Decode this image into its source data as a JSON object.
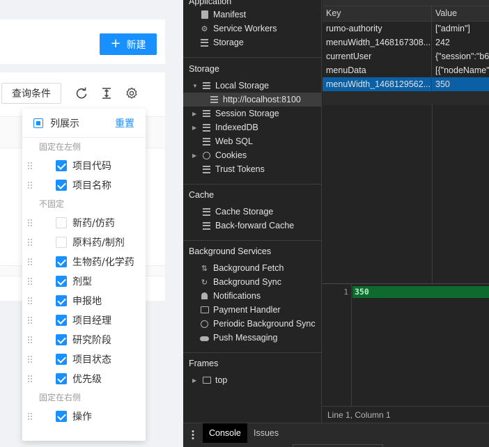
{
  "app": {
    "new_button": "新建",
    "query_button": "查询条件",
    "icons": [
      "reload-icon",
      "column-height-icon",
      "setting-icon"
    ],
    "column_panel": {
      "title": "列展示",
      "reset": "重置",
      "groups": [
        {
          "title": "固定在左侧",
          "items": [
            {
              "label": "项目代码",
              "checked": true
            },
            {
              "label": "项目名称",
              "checked": true
            }
          ]
        },
        {
          "title": "不固定",
          "items": [
            {
              "label": "新药/仿药",
              "checked": false
            },
            {
              "label": "原料药/制剂",
              "checked": false
            },
            {
              "label": "生物药/化学药",
              "checked": true
            },
            {
              "label": "剂型",
              "checked": true
            },
            {
              "label": "申报地",
              "checked": true
            },
            {
              "label": "项目经理",
              "checked": true
            },
            {
              "label": "研究阶段",
              "checked": true
            },
            {
              "label": "项目状态",
              "checked": true
            },
            {
              "label": "优先级",
              "checked": true
            }
          ]
        },
        {
          "title": "固定在右侧",
          "items": [
            {
              "label": "操作",
              "checked": true
            }
          ]
        }
      ]
    }
  },
  "devtools": {
    "application_label": "Application",
    "app_items": [
      "Manifest",
      "Service Workers",
      "Storage"
    ],
    "storage_label": "Storage",
    "local_storage": "Local Storage",
    "local_origin": "http://localhost:8100",
    "session_storage": "Session Storage",
    "indexeddb": "IndexedDB",
    "websql": "Web SQL",
    "cookies": "Cookies",
    "trust_tokens": "Trust Tokens",
    "cache_label": "Cache",
    "cache_items": [
      "Cache Storage",
      "Back-forward Cache"
    ],
    "bg_label": "Background Services",
    "bg_items": [
      "Background Fetch",
      "Background Sync",
      "Notifications",
      "Payment Handler",
      "Periodic Background Sync",
      "Push Messaging"
    ],
    "frames_label": "Frames",
    "frames_top": "top",
    "table": {
      "key_header": "Key",
      "value_header": "Value",
      "rows": [
        {
          "key": "rumo-authority",
          "value": "[\"admin\"]"
        },
        {
          "key": "menuWidth_1468167308...",
          "value": "242"
        },
        {
          "key": "currentUser",
          "value": "{\"session\":\"b6"
        },
        {
          "key": "menuData",
          "value": "[{\"nodeName\""
        },
        {
          "key": "menuWidth_1468129562...",
          "value": "350"
        }
      ]
    },
    "preview": {
      "line_number": "1",
      "code": "350",
      "status": "Line 1, Column 1"
    },
    "drawer_tabs": [
      "Console",
      "Issues"
    ]
  }
}
